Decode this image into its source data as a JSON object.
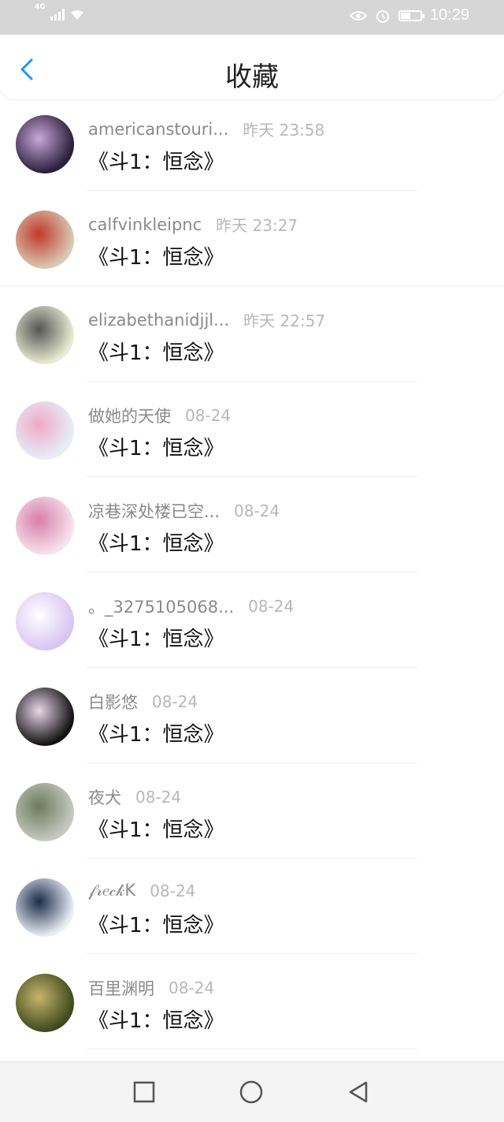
{
  "status_bar": {
    "network": "4G",
    "time": "10:29",
    "battery_level": 0.5,
    "icons": [
      "signal-icon",
      "wifi-icon",
      "eye-icon",
      "alarm-icon",
      "battery-icon"
    ]
  },
  "header": {
    "title": "收藏",
    "back_icon": "chevron-left-icon",
    "accent": "#2196f3"
  },
  "items": [
    {
      "name": "americanstouri...",
      "time": "昨天 23:58",
      "title": "《斗1：恒念》",
      "avatar_colors": [
        "#2a1e3c",
        "#c9a8d8"
      ]
    },
    {
      "name": "calfvinkleipnc",
      "time": "昨天 23:27",
      "title": "《斗1：恒念》",
      "avatar_colors": [
        "#d9c9b4",
        "#c0392b"
      ]
    },
    {
      "name": "elizabethanidjjl...",
      "time": "昨天 22:57",
      "title": "《斗1：恒念》",
      "avatar_colors": [
        "#e9ecd2",
        "#555555"
      ]
    },
    {
      "name": "做她的天使",
      "time": "08-24",
      "title": "《斗1：恒念》",
      "avatar_colors": [
        "#e6eef8",
        "#f0a9c6"
      ]
    },
    {
      "name": "凉巷深处楼已空...",
      "time": "08-24",
      "title": "《斗1：恒念》",
      "avatar_colors": [
        "#f7e3ec",
        "#d67fa8"
      ]
    },
    {
      "name": "。_3275105068...",
      "time": "08-24",
      "title": "《斗1：恒念》",
      "avatar_colors": [
        "#d8c5f3",
        "#ffffff"
      ]
    },
    {
      "name": "白影悠",
      "time": "08-24",
      "title": "《斗1：恒念》",
      "avatar_colors": [
        "#111111",
        "#e8d7e8"
      ]
    },
    {
      "name": "夜犬",
      "time": "08-24",
      "title": "《斗1：恒念》",
      "avatar_colors": [
        "#c7c9c1",
        "#6c7a5a"
      ]
    },
    {
      "name": "𝒻𝓇𝑒𝒸𝓀K",
      "time": "08-24",
      "title": "《斗1：恒念》",
      "avatar_colors": [
        "#e8eef6",
        "#1c2a48"
      ]
    },
    {
      "name": "百里渊明",
      "time": "08-24",
      "title": "《斗1：恒念》",
      "avatar_colors": [
        "#3d4a1e",
        "#c8b46a"
      ]
    }
  ],
  "nav_bar": {
    "icons": [
      "square-icon",
      "circle-icon",
      "triangle-back-icon"
    ]
  }
}
